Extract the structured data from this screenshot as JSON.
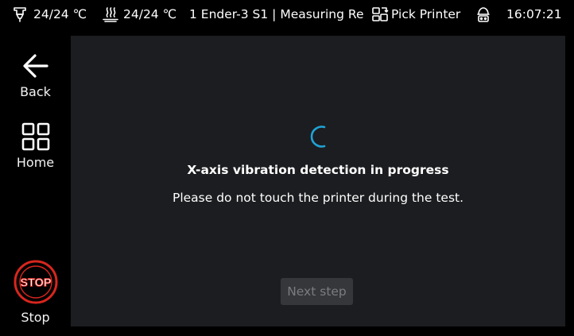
{
  "status_bar": {
    "nozzle_temp": "24/24 ℃",
    "bed_temp": "24/24 ℃",
    "printer_title": "1 Ender-3 S1 | Measuring Re",
    "pick_printer_label": "Pick Printer",
    "time": "16:07:21"
  },
  "nav": {
    "back_label": "Back",
    "home_label": "Home",
    "stop_label": "Stop",
    "stop_icon_text": "STOP"
  },
  "main": {
    "headline": "X-axis vibration detection in progress",
    "message": "Please do not touch the printer during the test.",
    "next_button_label": "Next step"
  },
  "colors": {
    "background": "#000000",
    "panel": "#1c1d20",
    "spinner_accent": "#1fa3d6",
    "stop_red": "#d7261e",
    "disabled_button_bg": "#35373b",
    "disabled_button_text": "#7a7c80"
  },
  "icons": {
    "nozzle": "nozzle-icon",
    "bed": "heated-bed-icon",
    "pick_printer": "pick-printer-icon",
    "robot": "robot-icon",
    "back": "arrow-left-icon",
    "home": "grid-icon",
    "stop": "stop-sign-icon",
    "spinner": "loading-spinner-icon"
  }
}
